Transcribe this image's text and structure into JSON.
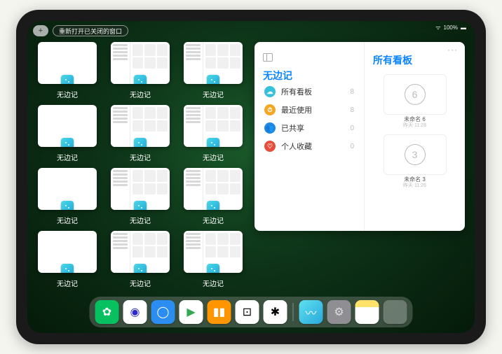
{
  "status": {
    "wifi_label": "100%",
    "signal": "●●●"
  },
  "top": {
    "plus": "+",
    "reopen_label": "重新打开已关闭的窗口"
  },
  "windows": [
    {
      "label": "无边记",
      "kind": "blank"
    },
    {
      "label": "无边记",
      "kind": "detail"
    },
    {
      "label": "无边记",
      "kind": "detail"
    },
    {
      "label": "无边记",
      "kind": "blank"
    },
    {
      "label": "无边记",
      "kind": "detail"
    },
    {
      "label": "无边记",
      "kind": "detail"
    },
    {
      "label": "无边记",
      "kind": "blank"
    },
    {
      "label": "无边记",
      "kind": "detail"
    },
    {
      "label": "无边记",
      "kind": "detail"
    },
    {
      "label": "无边记",
      "kind": "blank"
    },
    {
      "label": "无边记",
      "kind": "detail"
    },
    {
      "label": "无边记",
      "kind": "detail"
    }
  ],
  "app": {
    "title": "无边记",
    "right_title": "所有看板",
    "rows": [
      {
        "icon_color": "#35c1d9",
        "glyph": "☁",
        "label": "所有看板",
        "count": "8"
      },
      {
        "icon_color": "#f5a623",
        "glyph": "⏱",
        "label": "最近使用",
        "count": "8"
      },
      {
        "icon_color": "#1e88e5",
        "glyph": "👥",
        "label": "已共享",
        "count": "0"
      },
      {
        "icon_color": "#e74c3c",
        "glyph": "♡",
        "label": "个人收藏",
        "count": "0"
      }
    ],
    "boards": [
      {
        "digit": "6",
        "name": "未命名 6",
        "time": "昨天 11:28"
      },
      {
        "digit": "3",
        "name": "未命名 3",
        "time": "昨天 11:26"
      }
    ]
  },
  "dock": [
    {
      "name": "wechat",
      "bg": "#07c160",
      "glyph": "✿",
      "fg": "#fff"
    },
    {
      "name": "quark",
      "bg": "#ffffff",
      "glyph": "◉",
      "fg": "#2b2bd6"
    },
    {
      "name": "qqbrowser",
      "bg": "#2b8def",
      "glyph": "◯",
      "fg": "#fff"
    },
    {
      "name": "play",
      "bg": "#ffffff",
      "glyph": "▶",
      "fg": "#34a853"
    },
    {
      "name": "books",
      "bg": "#ff9500",
      "glyph": "▮▮",
      "fg": "#fff"
    },
    {
      "name": "dice",
      "bg": "#ffffff",
      "glyph": "⊡",
      "fg": "#000"
    },
    {
      "name": "connect",
      "bg": "#ffffff",
      "glyph": "✱",
      "fg": "#000"
    }
  ],
  "dock_recent": [
    {
      "name": "freeform",
      "bg": "linear-gradient(135deg,#5de1f0,#2aa8dc)",
      "glyph": "〰",
      "fg": "#fff"
    },
    {
      "name": "settings",
      "bg": "#8e8e93",
      "glyph": "⚙",
      "fg": "#ddd"
    },
    {
      "name": "notes",
      "bg": "linear-gradient(#ffe26a 30%,#fff 30%)",
      "glyph": "",
      "fg": "#000"
    }
  ]
}
